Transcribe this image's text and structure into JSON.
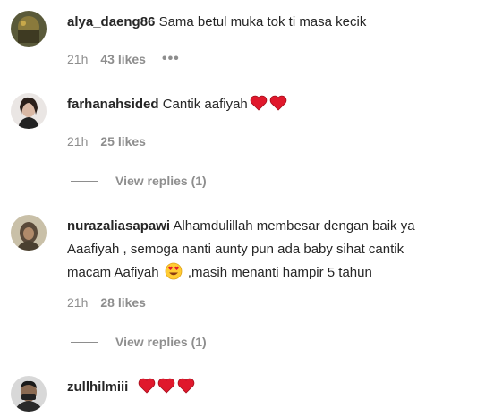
{
  "comments": [
    {
      "username": "alya_daeng86",
      "text": "Sama betul muka tok ti masa kecik",
      "time": "21h",
      "likes": "43 likes",
      "more_icon": "more-horizontal-icon"
    },
    {
      "username": "farhanahsided",
      "text": "Cantik aafiyah",
      "emoji": [
        "heart",
        "heart"
      ],
      "time": "21h",
      "likes": "25 likes",
      "replies": "View replies (1)"
    },
    {
      "username": "nurazaliasapawi",
      "text_1": "Alhamdulillah membesar dengan baik ya",
      "text_2": "Aaafiyah , semoga nanti aunty pun ada baby sihat cantik",
      "text_3a": "macam Aafiyah",
      "text_3b": ",masih menanti hampir 5 tahun",
      "emoji": [
        "smiling-face-with-heart-eyes"
      ],
      "time": "21h",
      "likes": "28 likes",
      "replies": "View replies (1)"
    },
    {
      "username": "zullhilmiii",
      "emoji": [
        "heart",
        "heart",
        "heart"
      ]
    }
  ],
  "colors": {
    "text": "#262626",
    "secondary": "#8e8e8e",
    "heart": "#e0182c"
  }
}
